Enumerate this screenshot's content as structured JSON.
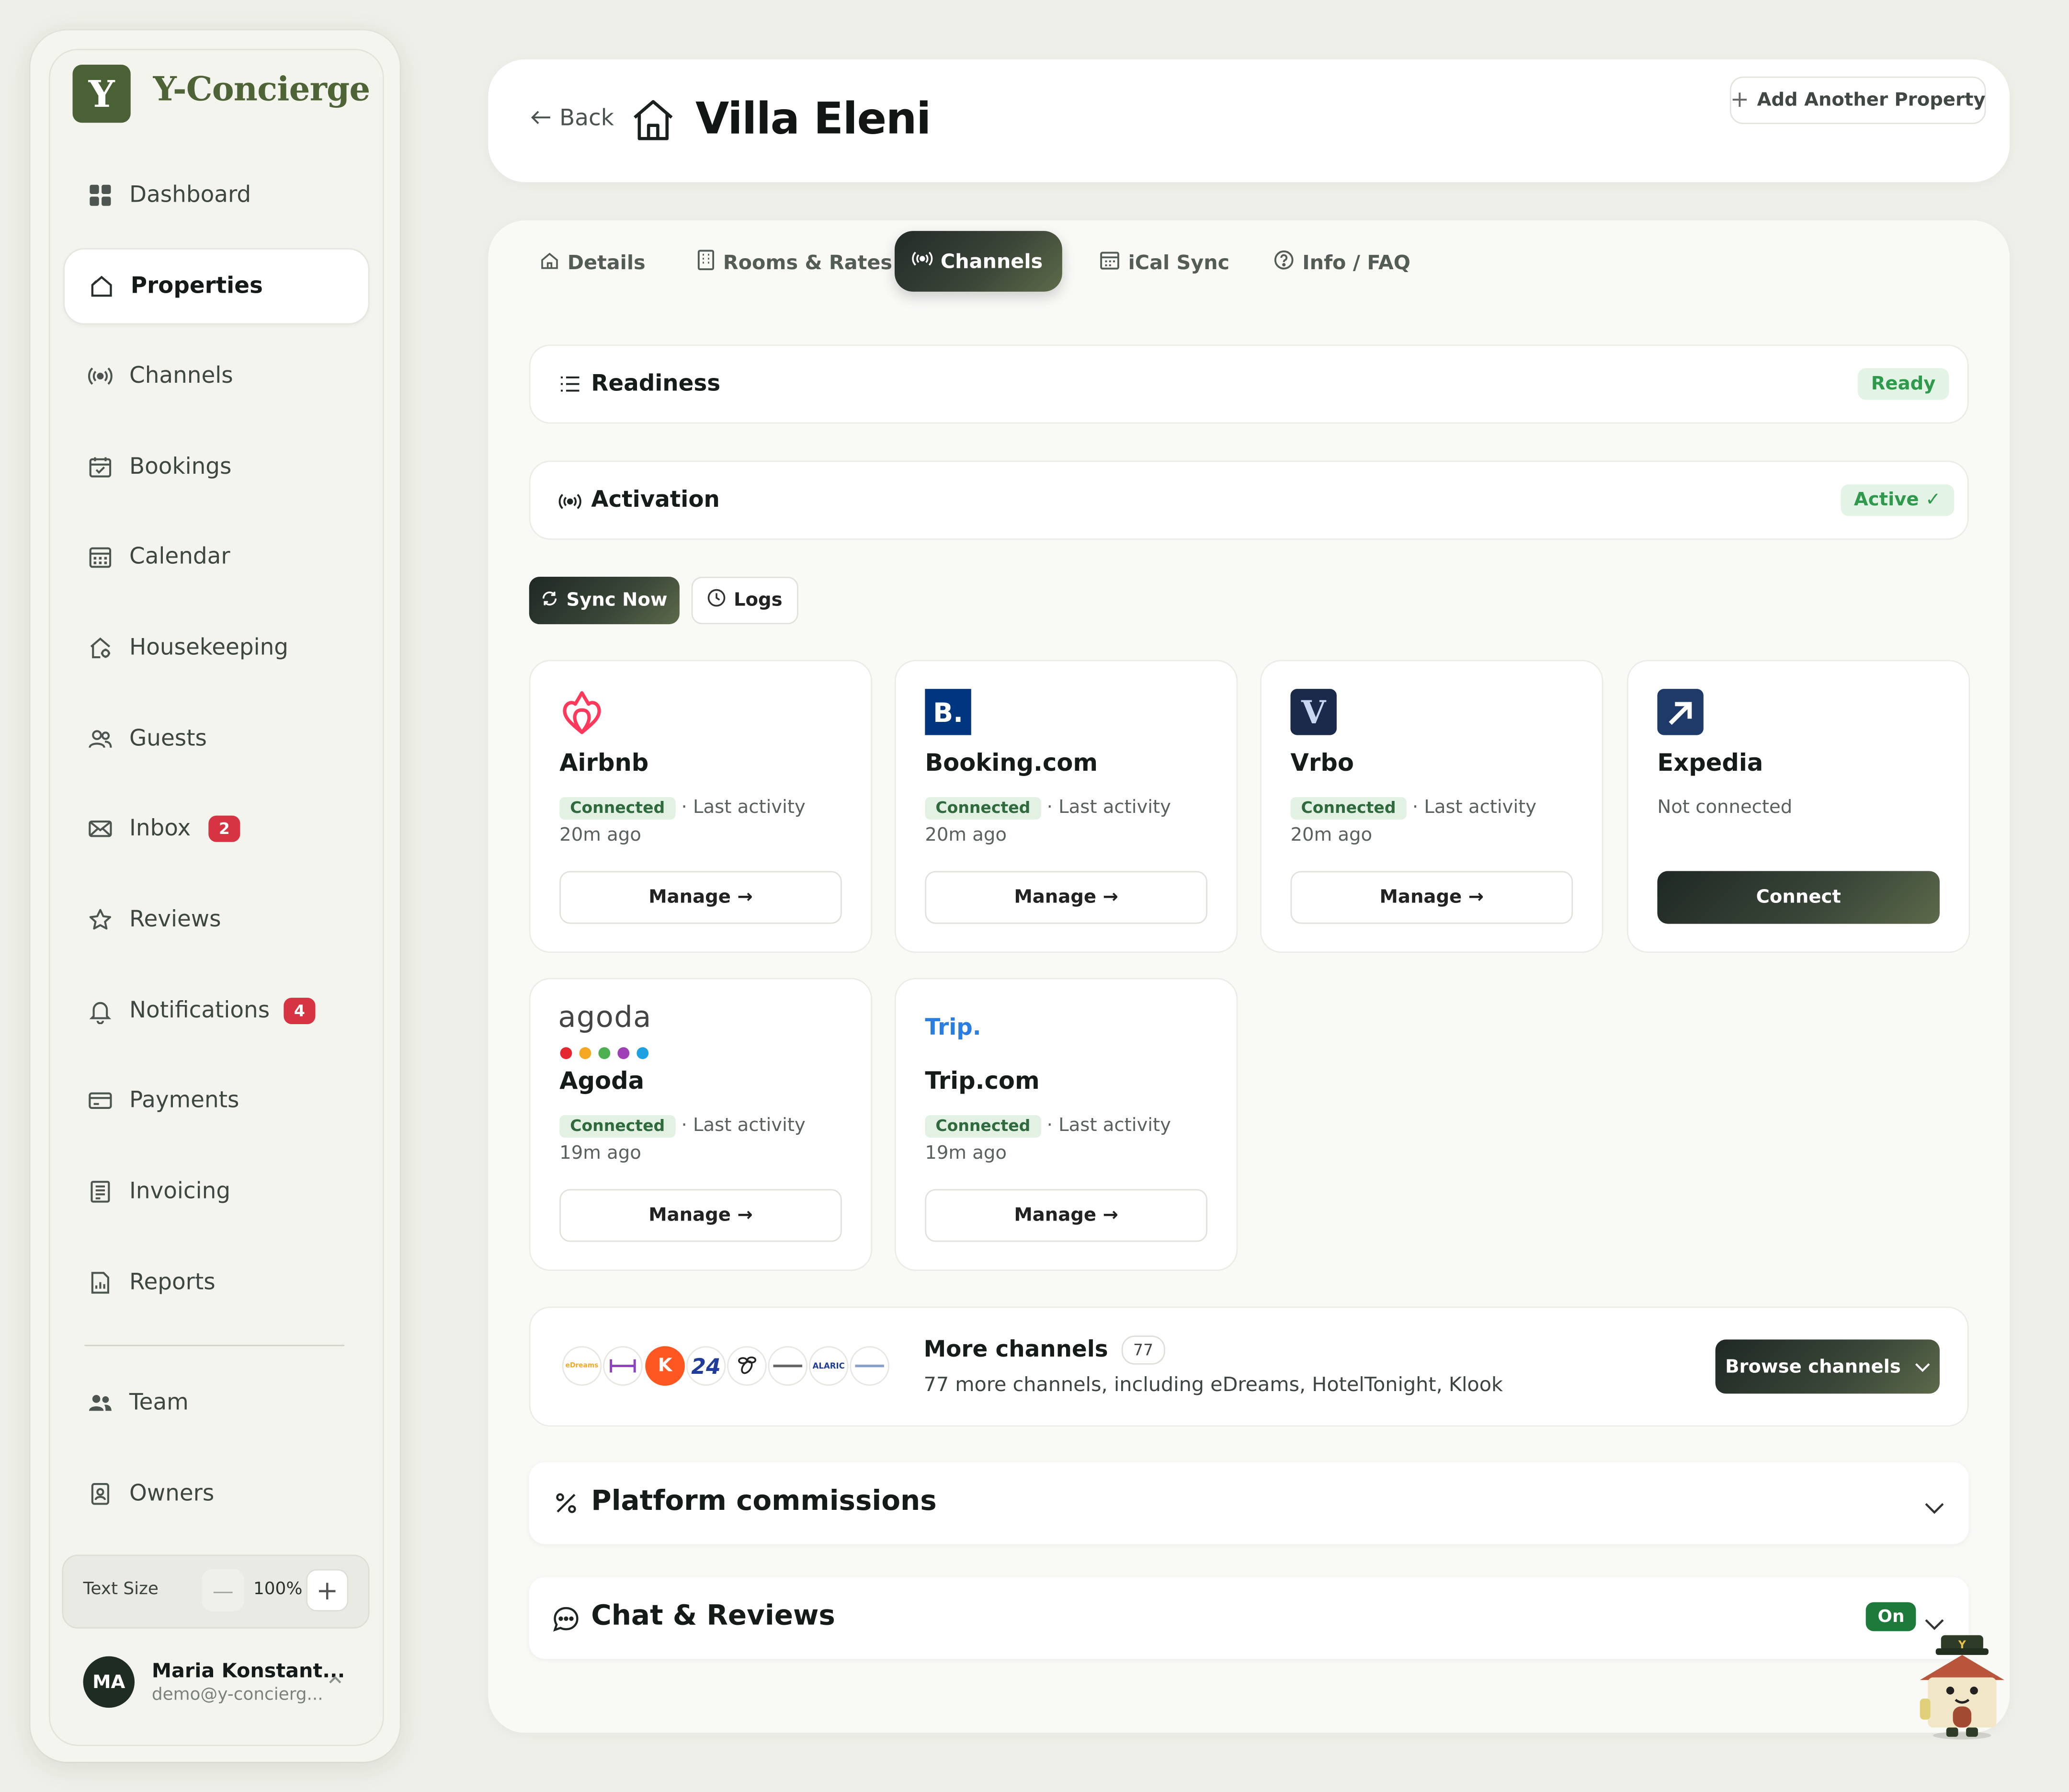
{
  "brand": {
    "logo_letter": "Y",
    "name": "Y-Concierge",
    "color": "#4a6136"
  },
  "sidebar": {
    "items": [
      {
        "label": "Dashboard",
        "icon": "grid-icon"
      },
      {
        "label": "Properties",
        "icon": "home-outline-icon",
        "active": true
      },
      {
        "label": "Channels",
        "icon": "broadcast-icon"
      },
      {
        "label": "Bookings",
        "icon": "calendar-check-icon"
      },
      {
        "label": "Calendar",
        "icon": "calendar-icon"
      },
      {
        "label": "Housekeeping",
        "icon": "house-gear-icon"
      },
      {
        "label": "Guests",
        "icon": "users-icon"
      },
      {
        "label": "Inbox",
        "icon": "mail-icon",
        "badge": "2"
      },
      {
        "label": "Reviews",
        "icon": "star-icon"
      },
      {
        "label": "Notifications",
        "icon": "bell-icon",
        "badge": "4"
      },
      {
        "label": "Payments",
        "icon": "credit-card-icon"
      },
      {
        "label": "Invoicing",
        "icon": "receipt-icon"
      },
      {
        "label": "Reports",
        "icon": "report-icon"
      },
      {
        "label": "Team",
        "icon": "team-icon"
      },
      {
        "label": "Owners",
        "icon": "id-badge-icon"
      }
    ],
    "text_size": {
      "label": "Text Size",
      "minus": "—",
      "value": "100%",
      "plus": "+"
    },
    "user": {
      "initials": "MA",
      "name": "Maria Konstant...",
      "email": "demo@y-concierg..."
    }
  },
  "header": {
    "back_label": "Back",
    "title": "Villa Eleni",
    "add_property_label": "Add Another Property"
  },
  "tabs": [
    {
      "label": "Details",
      "icon": "home-icon"
    },
    {
      "label": "Rooms & Rates",
      "icon": "building-icon"
    },
    {
      "label": "Channels",
      "icon": "broadcast-icon",
      "active": true
    },
    {
      "label": "iCal Sync",
      "icon": "calendar-icon"
    },
    {
      "label": "Info / FAQ",
      "icon": "help-circle-icon"
    }
  ],
  "readiness": {
    "title": "Readiness",
    "status": "Ready"
  },
  "activation": {
    "title": "Activation",
    "status": "Active ✓"
  },
  "actions": {
    "sync_label": "Sync Now",
    "logs_label": "Logs"
  },
  "channels": [
    {
      "name": "Airbnb",
      "tag": "Connected",
      "activity": "· Last activity 20m ago",
      "button": "Manage →"
    },
    {
      "name": "Booking.com",
      "logo_text": "B.",
      "tag": "Connected",
      "activity": "· Last activity 20m ago",
      "button": "Manage →"
    },
    {
      "name": "Vrbo",
      "logo_text": "V",
      "tag": "Connected",
      "activity": "· Last activity 20m ago",
      "button": "Manage →"
    },
    {
      "name": "Expedia",
      "status": "Not connected",
      "button": "Connect"
    },
    {
      "name": "Agoda",
      "logo_text": "agoda",
      "tag": "Connected",
      "activity": "· Last activity 19m ago",
      "button": "Manage →"
    },
    {
      "name": "Trip.com",
      "logo_text": "Trip.",
      "tag": "Connected",
      "activity": "· Last activity 19m ago",
      "button": "Manage →"
    }
  ],
  "more_channels": {
    "title": "More channels",
    "count": "77",
    "subtitle": "77 more channels, including eDreams, HotelTonight, Klook",
    "button": "Browse channels",
    "logos": [
      "eDreams",
      "K",
      "24",
      "ALARIC"
    ]
  },
  "commissions": {
    "title": "Platform commissions"
  },
  "chat_reviews": {
    "title": "Chat & Reviews",
    "status": "On"
  },
  "colors": {
    "accent_green": "#2f9a4c",
    "badge_red": "#d63343",
    "dark": "#232b28"
  }
}
